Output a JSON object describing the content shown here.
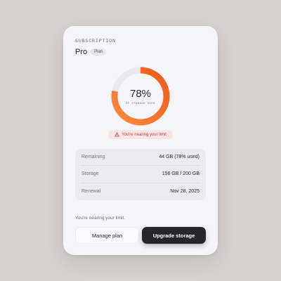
{
  "subscription": {
    "eyebrow": "SUBSCRIPTION",
    "plan_name": "Pro",
    "plan_tag": "Plan"
  },
  "usage": {
    "percent_used": 78,
    "percent_label": "78%",
    "caption": "OF STORAGE USED",
    "ring_color_start": "#ff8a3d",
    "ring_color_end": "#f05a1a",
    "track_color": "#e9e8ee"
  },
  "warning": {
    "icon": "warning-triangle-icon",
    "text": "You're nearing your limit",
    "color": "#a94a43"
  },
  "stats": [
    {
      "label": "Remaining",
      "value": "44 GB (78% used)"
    },
    {
      "label": "Storage",
      "value": "156 GB / 200 GB"
    },
    {
      "label": "Renewal",
      "value": "Nov 28, 2025"
    }
  ],
  "footer": {
    "note": "You're nearing your limit."
  },
  "actions": {
    "manage_label": "Manage plan",
    "upgrade_label": "Upgrade storage"
  }
}
